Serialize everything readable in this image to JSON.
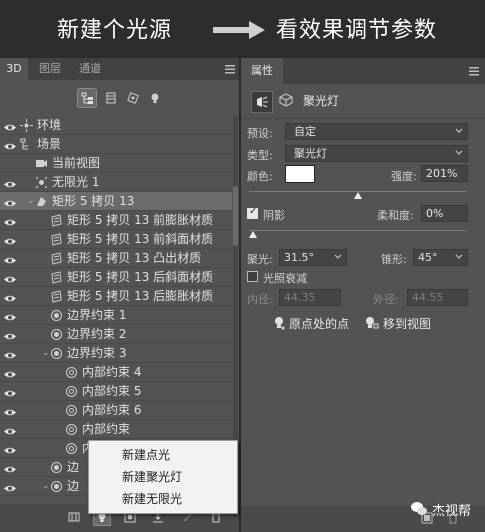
{
  "banner": {
    "left_text": "新建个光源",
    "right_text": "看效果调节参数"
  },
  "left_panel": {
    "tabs": [
      "3D",
      "图层",
      "通道"
    ],
    "tree": [
      {
        "label": "环境",
        "icon": "environment-icon",
        "level": 0,
        "eye": true
      },
      {
        "label": "场景",
        "icon": "scene-icon",
        "level": 0,
        "eye": true
      },
      {
        "label": "当前视图",
        "icon": "camera-icon",
        "level": 1,
        "eye": false
      },
      {
        "label": "无限光 1",
        "icon": "infinite-light-icon",
        "level": 1,
        "eye": true
      },
      {
        "label": "矩形 5 拷贝 13",
        "icon": "mesh-icon",
        "level": 1,
        "eye": true,
        "expanded": true,
        "selected": true
      },
      {
        "label": "矩形 5 拷贝 13 前膨胀材质",
        "icon": "material-icon",
        "level": 2,
        "eye": true
      },
      {
        "label": "矩形 5 拷贝 13 前斜面材质",
        "icon": "material-icon",
        "level": 2,
        "eye": true
      },
      {
        "label": "矩形 5 拷贝 13 凸出材质",
        "icon": "material-icon",
        "level": 2,
        "eye": true
      },
      {
        "label": "矩形 5 拷贝 13 后斜面材质",
        "icon": "material-icon",
        "level": 2,
        "eye": true
      },
      {
        "label": "矩形 5 拷贝 13 后膨胀材质",
        "icon": "material-icon",
        "level": 2,
        "eye": true
      },
      {
        "label": "边界约束 1",
        "icon": "constraint-icon",
        "level": 2,
        "eye": true
      },
      {
        "label": "边界约束 2",
        "icon": "constraint-icon",
        "level": 2,
        "eye": true
      },
      {
        "label": "边界约束 3",
        "icon": "constraint-icon",
        "level": 2,
        "eye": true,
        "expanded": true
      },
      {
        "label": "内部约束 4",
        "icon": "inner-constraint-icon",
        "level": 3,
        "eye": true
      },
      {
        "label": "内部约束 5",
        "icon": "inner-constraint-icon",
        "level": 3,
        "eye": true
      },
      {
        "label": "内部约束 6",
        "icon": "inner-constraint-icon",
        "level": 3,
        "eye": true
      },
      {
        "label": "内部约束",
        "icon": "inner-constraint-icon",
        "level": 3,
        "eye": true
      },
      {
        "label": "内部约束",
        "icon": "inner-constraint-icon",
        "level": 3,
        "eye": true
      },
      {
        "label": "边",
        "icon": "constraint-icon",
        "level": 2,
        "eye": true
      },
      {
        "label": "边",
        "icon": "constraint-icon",
        "level": 2,
        "eye": true,
        "expanded": true
      }
    ],
    "popup_menu": [
      "新建点光",
      "新建聚光灯",
      "新建无限光"
    ]
  },
  "right_panel": {
    "tab": "属性",
    "title": "聚光灯",
    "preset_label": "预设:",
    "preset_value": "自定",
    "type_label": "类型:",
    "type_value": "聚光灯",
    "color_label": "颜色:",
    "color_value": "#ffffff",
    "intensity_label": "强度:",
    "intensity_value": "201%",
    "intensity_fraction": 0.5,
    "shadow_label": "阴影",
    "shadow_checked": true,
    "softness_label": "柔和度:",
    "softness_value": "0%",
    "softness_fraction": 0.0,
    "hotspot_label": "聚光:",
    "hotspot_value": "31.5°",
    "cone_label": "锥形:",
    "cone_value": "45°",
    "falloff_label": "光照衰减",
    "falloff_checked": false,
    "inner_label": "内径:",
    "inner_value": "44.35",
    "outer_label": "外径:",
    "outer_value": "44.55",
    "move_to_origin_label": "原点处的点",
    "move_to_view_label": "移到视图"
  },
  "watermark": {
    "text": "杰视帮"
  },
  "colors": {
    "panel_bg": "#535353",
    "tab_bg": "#424242",
    "banner_bg": "#2d2d2d",
    "popup_bg": "#f2f2f2"
  }
}
